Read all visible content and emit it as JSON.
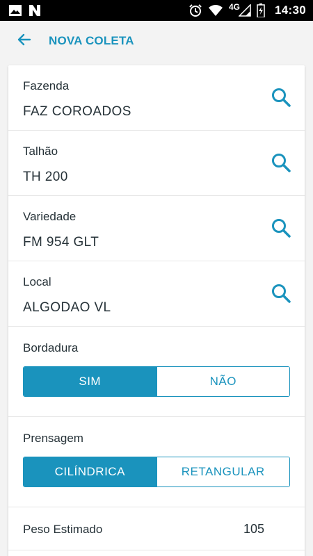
{
  "status_bar": {
    "time": "14:30",
    "network": "4G",
    "icons": [
      "image-icon",
      "n-app-icon",
      "alarm-icon",
      "wifi-icon",
      "signal-icon",
      "battery-icon"
    ]
  },
  "app_bar": {
    "title": "NOVA COLETA",
    "back_icon": "arrow-left-icon"
  },
  "colors": {
    "accent": "#1a93bd",
    "text": "#263238",
    "background": "#f3f3f3",
    "card": "#ffffff"
  },
  "fields": [
    {
      "label": "Fazenda",
      "value": "FAZ COROADOS",
      "icon": "search-icon"
    },
    {
      "label": "Talhão",
      "value": "TH 200",
      "icon": "search-icon"
    },
    {
      "label": "Variedade",
      "value": "FM 954 GLT",
      "icon": "search-icon"
    },
    {
      "label": "Local",
      "value": "ALGODAO VL",
      "icon": "search-icon"
    }
  ],
  "bordadura": {
    "label": "Bordadura",
    "options": [
      "SIM",
      "NÃO"
    ],
    "selected": "SIM"
  },
  "prensagem": {
    "label": "Prensagem",
    "options": [
      "CILÍNDRICA",
      "RETANGULAR"
    ],
    "selected": "CILÍNDRICA"
  },
  "peso": {
    "label": "Peso Estimado",
    "value": "105"
  }
}
